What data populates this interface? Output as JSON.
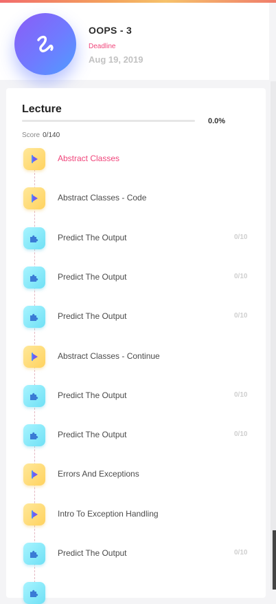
{
  "course": {
    "title": "OOPS - 3",
    "deadline_label": "Deadline",
    "deadline_date": "Aug 19, 2019"
  },
  "section": {
    "title": "Lecture",
    "progress_percent_label": "0.0%",
    "progress_fraction": 0.0,
    "score_label": "Score",
    "score_value": "0/140"
  },
  "colors": {
    "accent": "#f0447a",
    "video_icon": "#ffd25e",
    "puzzle_icon": "#6fe0f5"
  },
  "items": [
    {
      "type": "video",
      "icon": "play-icon",
      "label": "Abstract Classes",
      "score": "",
      "active": true
    },
    {
      "type": "video",
      "icon": "play-icon",
      "label": "Abstract Classes - Code",
      "score": ""
    },
    {
      "type": "puzzle",
      "icon": "puzzle-icon",
      "label": "Predict The Output",
      "score": "0/10"
    },
    {
      "type": "puzzle",
      "icon": "puzzle-icon",
      "label": "Predict The Output",
      "score": "0/10"
    },
    {
      "type": "puzzle",
      "icon": "puzzle-icon",
      "label": "Predict The Output",
      "score": "0/10"
    },
    {
      "type": "video",
      "icon": "play-icon",
      "label": "Abstract Classes - Continue",
      "score": ""
    },
    {
      "type": "puzzle",
      "icon": "puzzle-icon",
      "label": "Predict The Output",
      "score": "0/10"
    },
    {
      "type": "puzzle",
      "icon": "puzzle-icon",
      "label": "Predict The Output",
      "score": "0/10"
    },
    {
      "type": "video",
      "icon": "play-icon",
      "label": "Errors And Exceptions",
      "score": ""
    },
    {
      "type": "video",
      "icon": "play-icon",
      "label": "Intro To Exception Handling",
      "score": ""
    },
    {
      "type": "puzzle",
      "icon": "puzzle-icon",
      "label": "Predict The Output",
      "score": "0/10"
    },
    {
      "type": "puzzle",
      "icon": "puzzle-icon",
      "label": "",
      "score": ""
    }
  ]
}
